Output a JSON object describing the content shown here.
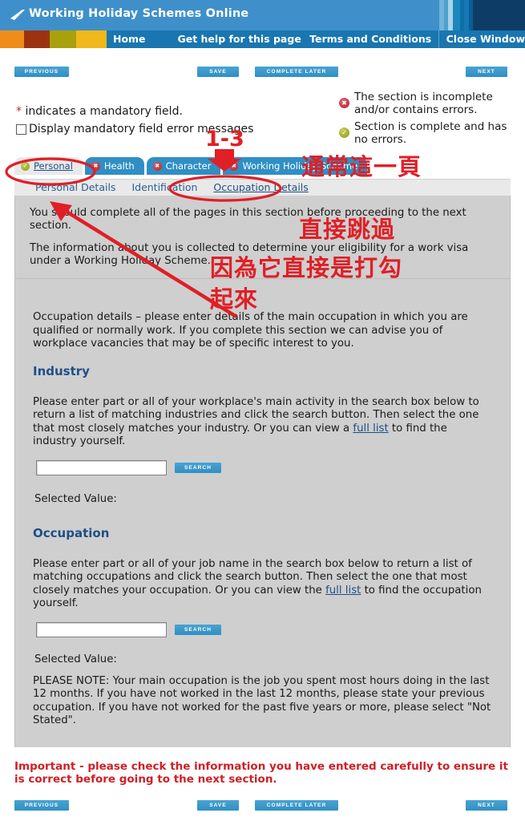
{
  "header": {
    "title": "Working Holiday Schemes Online",
    "logo_icon": "tick-swoosh-icon",
    "stripes": [
      "#3f90ca",
      "#6fb4da",
      "#4fa0cf",
      "#a8d4e8",
      "#1b87bd",
      "#0c6fa8",
      "#1479b4",
      "#0a5d96",
      "#0d3d66",
      "#0d3d66"
    ],
    "nav": [
      {
        "label": "Home"
      },
      {
        "label": "Get help for this page"
      },
      {
        "label": "Terms and Conditions"
      },
      {
        "label": "Close Window"
      }
    ],
    "swatch_colors": [
      "#f08c1a",
      "#9c3310",
      "#a8a10c",
      "#f0b81a"
    ]
  },
  "toolbar": {
    "previous": "Previous",
    "save": "Save",
    "complete_later": "Complete Later",
    "next": "Next"
  },
  "legend": {
    "mandatory_note_star": "*",
    "mandatory_note": " indicates a mandatory field.",
    "display_errors_label": "Display mandatory field error messages",
    "display_errors_checked": false,
    "items": [
      {
        "icon": "error-dot-icon",
        "status": "error",
        "text": "The section is incomplete and/or contains errors."
      },
      {
        "icon": "complete-dot-icon",
        "status": "ok",
        "text": "Section is complete and has no errors."
      }
    ]
  },
  "tabs": [
    {
      "label": "Personal",
      "status": "ok",
      "active": true
    },
    {
      "label": "Health",
      "status": "error",
      "active": false
    },
    {
      "label": "Character",
      "status": "error",
      "active": false
    },
    {
      "label": "Working Holiday Scheme",
      "status": "error",
      "active": false
    }
  ],
  "subtabs": [
    {
      "label": "Personal Details",
      "active": false
    },
    {
      "label": "Identification",
      "active": false
    },
    {
      "label": "Occupation Details",
      "active": true
    }
  ],
  "body": {
    "intro1": "You should complete all of the pages in this section before proceeding to the next section.",
    "intro2": "The information about you is collected to determine your eligibility for a work visa under a Working Holiday Scheme.",
    "occupation_intro": "Occupation details – please enter details of the main occupation in which you are qualified or normally work. If you complete this section we can advise you of workplace vacancies that may be of specific interest to you.",
    "industry": {
      "heading": "Industry",
      "desc_a": "Please enter part or all of your workplace's main activity in the search box below to return a list of matching industries and click the search button. Then select the one that most closely matches your industry. Or you can view a ",
      "link": "full list",
      "desc_b": " to find the industry yourself.",
      "input_value": "",
      "input_placeholder": "",
      "search_label": "Search",
      "selected_value_label": "Selected Value:",
      "selected_value": ""
    },
    "occupation": {
      "heading": "Occupation",
      "desc_a": "Please enter part or all of your job name in the search box below to return a list of matching occupations and click the search button. Then select the one that most closely matches your occupation. Or you can view the ",
      "link": "full list",
      "desc_b": " to find the occupation yourself.",
      "input_value": "",
      "input_placeholder": "",
      "search_label": "Search",
      "selected_value_label": "Selected Value:",
      "selected_value": "",
      "please_note": "PLEASE NOTE: Your main occupation is the job you spent most hours doing in the last 12 months. If you have not worked in the last 12 months, please state your previous occupation. If you have not worked for the past five years or more, please select \"Not Stated\"."
    }
  },
  "footer": {
    "important": "Important - please check the information you have entered carefully to ensure it is correct before going to the next section."
  },
  "annotations": {
    "color": "#e01f26",
    "one_to_three": "1-3",
    "usually_this_page": "通常這一頁",
    "skip_directly": "直接跳過",
    "because_checked_line1": "因為它直接是打勾",
    "because_checked_line2": "起來",
    "circles": [
      "personal-tab-circle",
      "occupation-details-circle"
    ],
    "arrows": [
      "down-arrow-to-tabs",
      "diagonal-arrow-to-intro"
    ]
  }
}
